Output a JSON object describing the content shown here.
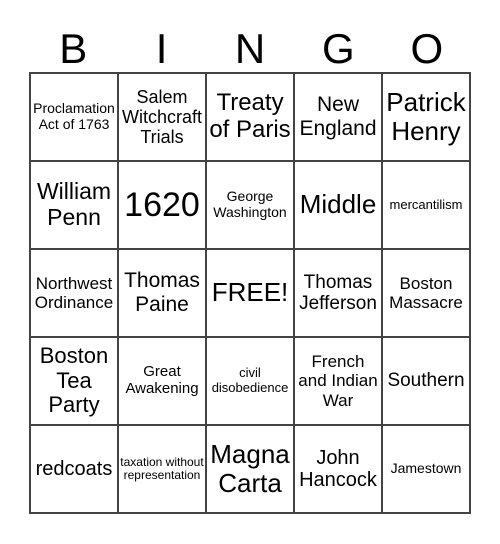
{
  "header": [
    "B",
    "I",
    "N",
    "G",
    "O"
  ],
  "cells": [
    "Proclamation Act of 1763",
    "Salem Witchcraft Trials",
    "Treaty of Paris",
    "New England",
    "Patrick Henry",
    "William Penn",
    "1620",
    "George Washington",
    "Middle",
    "mercantilism",
    "Northwest Ordinance",
    "Thomas Paine",
    "FREE!",
    "Thomas Jefferson",
    "Boston Massacre",
    "Boston Tea Party",
    "Great Awakening",
    "civil disobedience",
    "French and Indian War",
    "Southern",
    "redcoats",
    "taxation without representation",
    "Magna Carta",
    "John Hancock",
    "Jamestown"
  ]
}
